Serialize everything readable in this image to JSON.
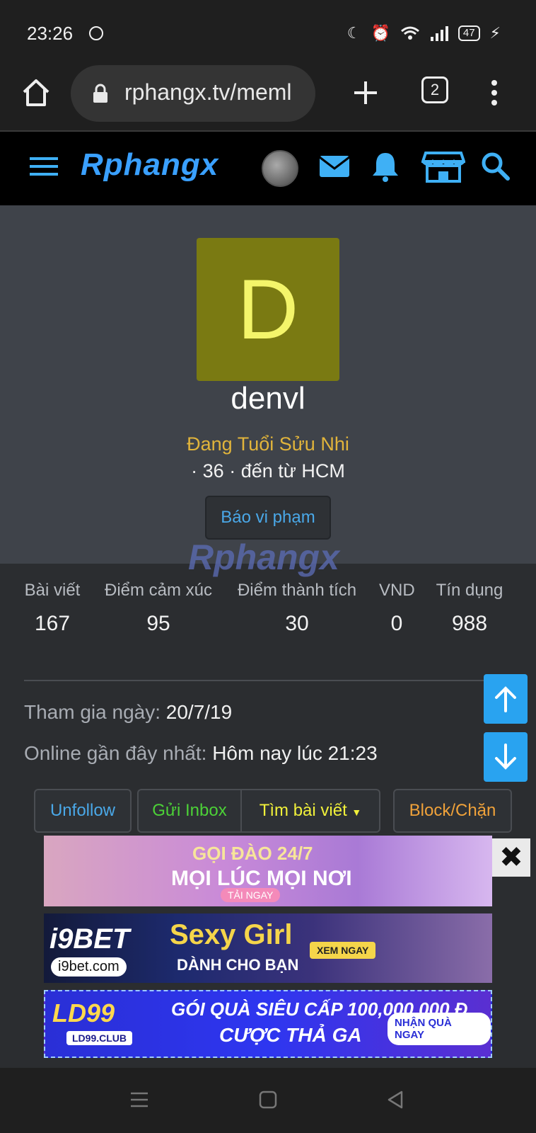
{
  "status_bar": {
    "time": "23:26",
    "battery": "47"
  },
  "browser": {
    "url": "rphangx.tv/meml",
    "tab_count": "2"
  },
  "site": {
    "logo_text": "Rphangx"
  },
  "profile": {
    "avatar_letter": "D",
    "username": "denvl",
    "user_title": "Đang Tuổi Sửu Nhi",
    "meta": "· 36 · đến từ HCM",
    "report_button": "Báo vi phạm",
    "watermark": "Rphangx"
  },
  "stats": [
    {
      "label": "Bài viết",
      "value": "167"
    },
    {
      "label": "Điểm cảm xúc",
      "value": "95"
    },
    {
      "label": "Điểm thành tích",
      "value": "30"
    },
    {
      "label": "VND",
      "value": "0"
    },
    {
      "label": "Tín dụng",
      "value": "988"
    }
  ],
  "info": {
    "joined_label": "Tham gia ngày:",
    "joined_value": "20/7/19",
    "online_label": "Online gần đây nhất:",
    "online_value": "Hôm nay lúc 21:23"
  },
  "actions": {
    "unfollow": "Unfollow",
    "inbox": "Gửi Inbox",
    "find_posts": "Tìm bài viết",
    "block": "Block/Chặn"
  },
  "colors": {
    "accent_blue": "#4aa8e8",
    "title_gold": "#e1b43b",
    "inbox_green": "#4cd137",
    "find_yellow": "#f1f13a",
    "block_orange": "#f0a23a"
  },
  "ads": {
    "ad1_line1": "GỌI ĐÀO 24/7",
    "ad1_line2": "MỌI LÚC MỌI NƠI",
    "ad1_cta": "TẢI NGAY",
    "ad2_brand": "i9BET",
    "ad2_domain": "i9bet.com",
    "ad2_big": "Sexy Girl",
    "ad2_sub": "DÀNH CHO BẠN",
    "ad2_cta": "XEM NGAY",
    "ad3_brand": "LD99",
    "ad3_domain": "LD99.CLUB",
    "ad3_big": "GÓI QUÀ SIÊU CẤP 100,000,000 Đ",
    "ad3_sub": "CƯỢC THẢ GA",
    "ad3_cta": "NHẬN QUÀ NGAY",
    "close_symbol": "✖"
  }
}
